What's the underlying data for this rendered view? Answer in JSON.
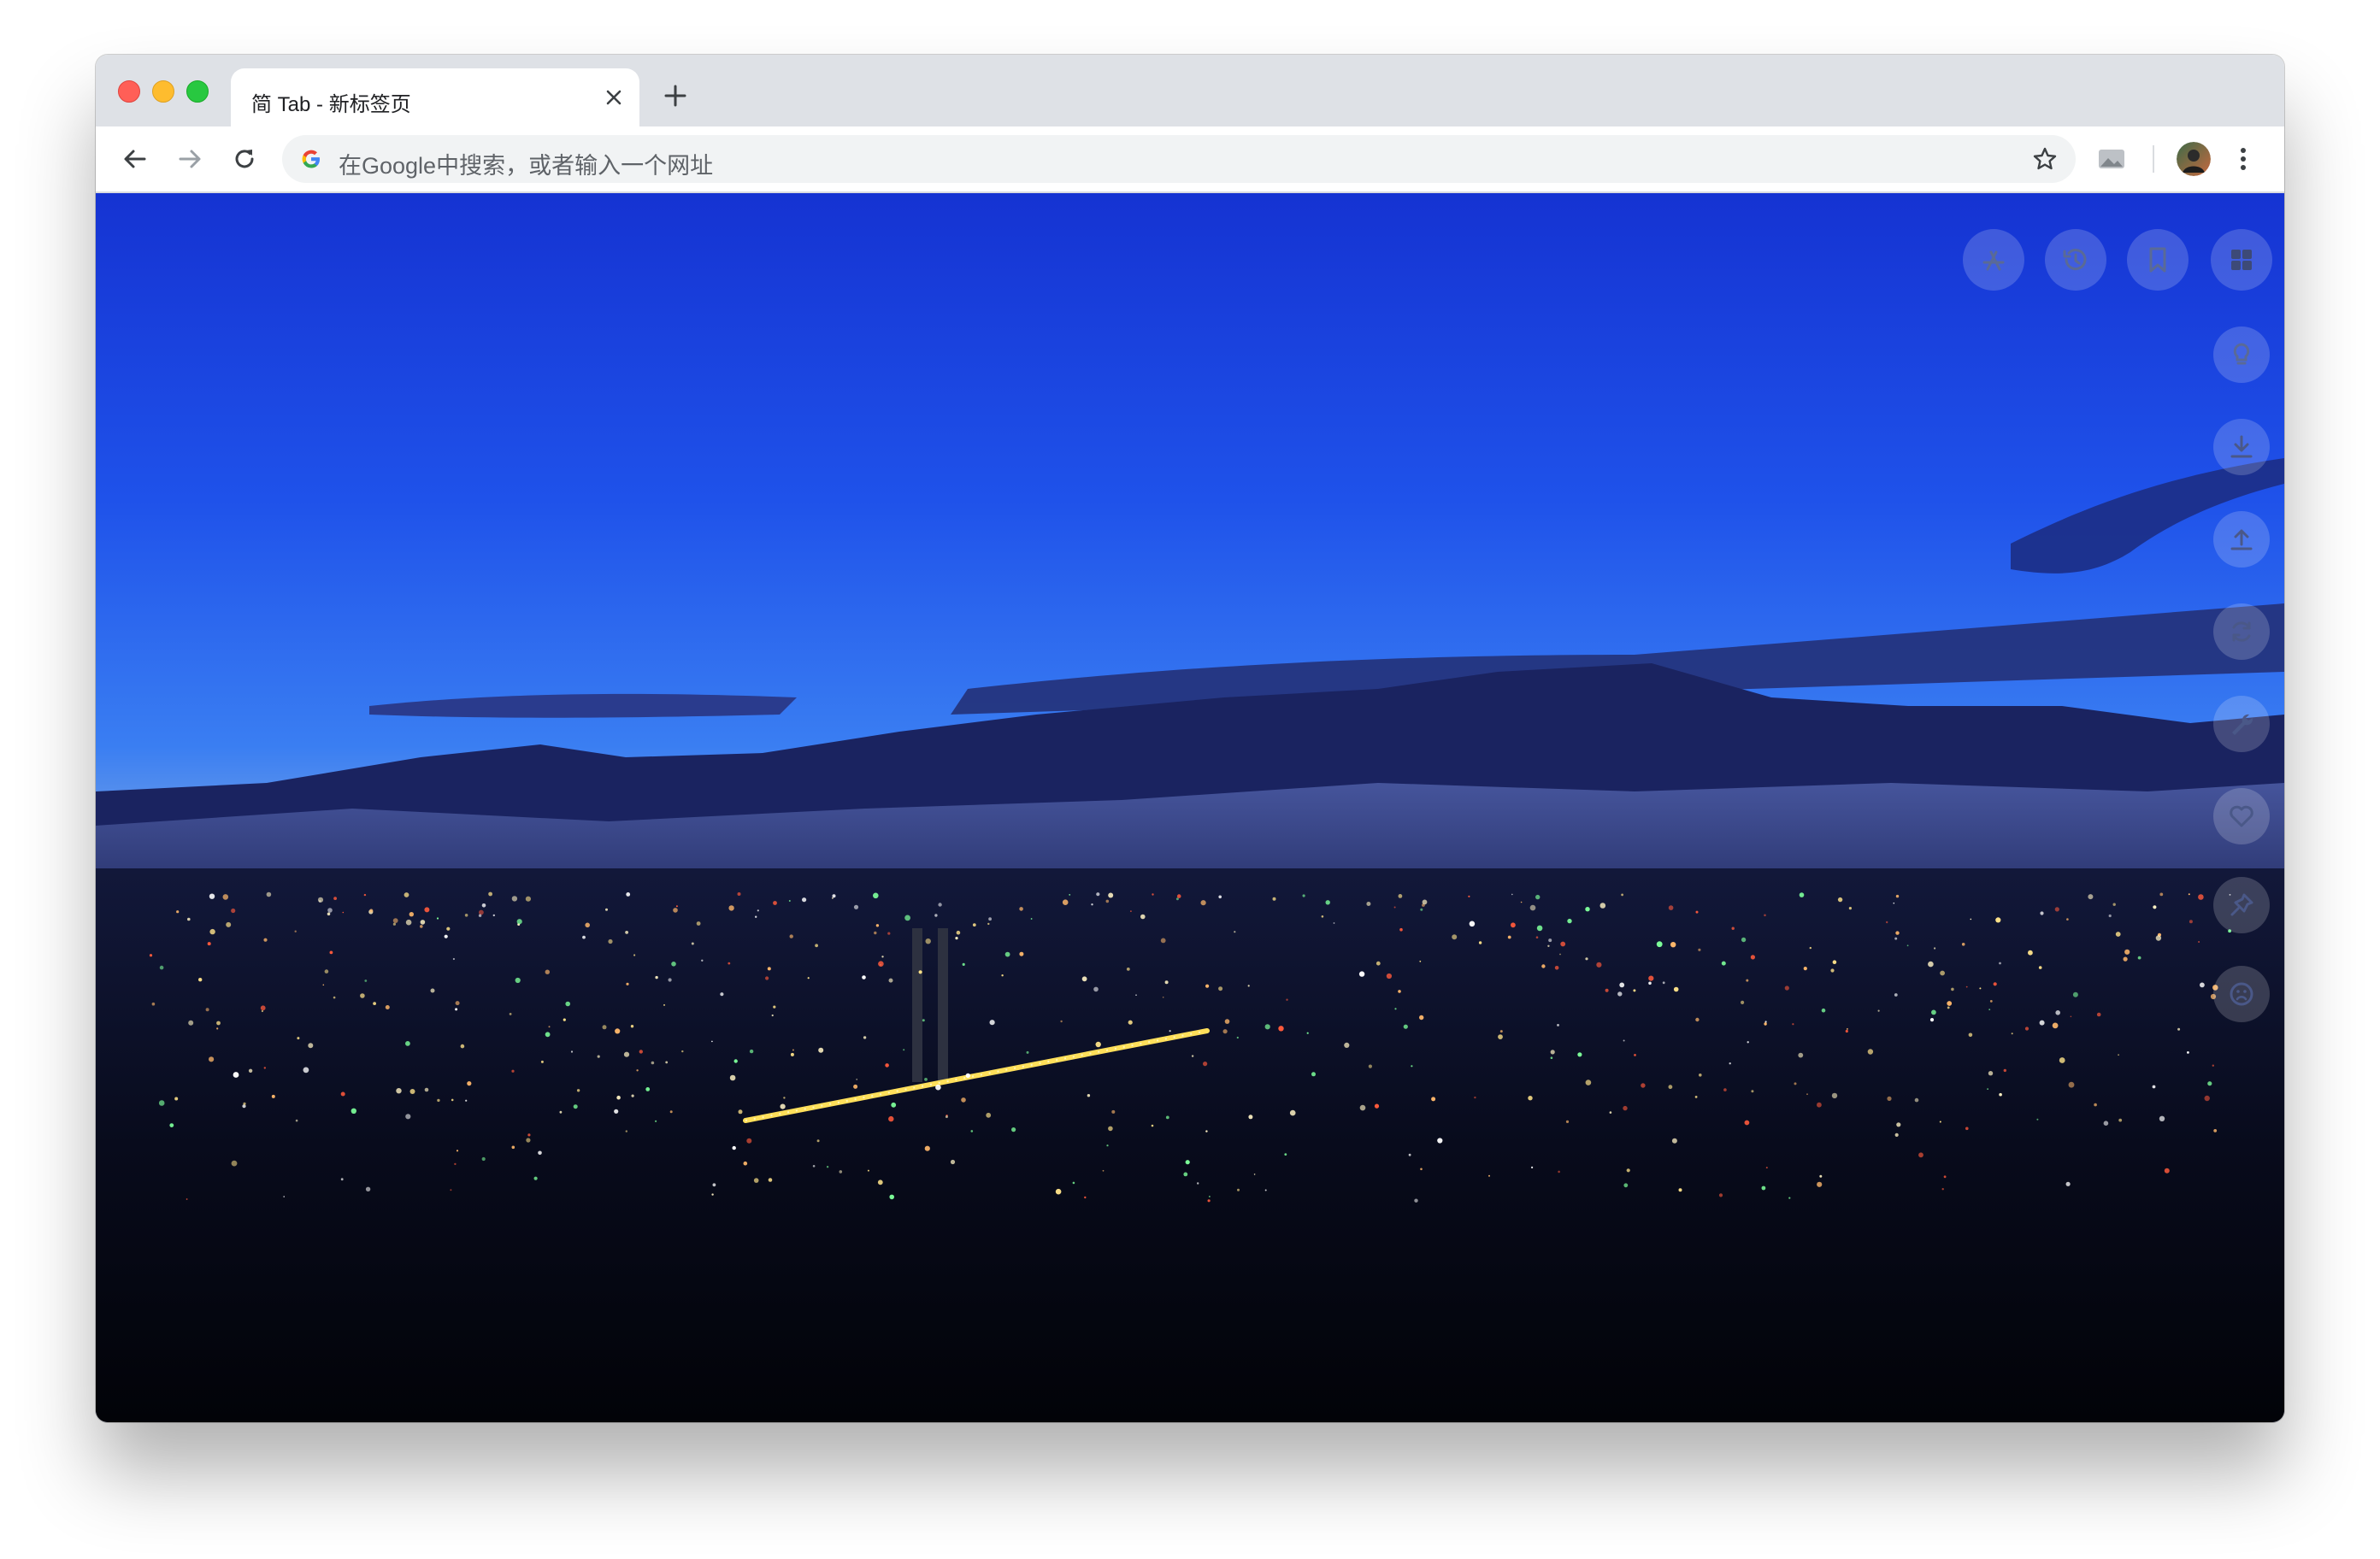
{
  "browser": {
    "tab": {
      "title": "简 Tab - 新标签页"
    },
    "omnibox": {
      "placeholder": "在Google中搜索，或者输入一个网址"
    }
  },
  "newtab": {
    "top_actions": [
      {
        "icon": "app-store-icon"
      },
      {
        "icon": "history-icon"
      },
      {
        "icon": "bookmark-icon"
      },
      {
        "icon": "grid-icon"
      }
    ],
    "side_actions": [
      {
        "icon": "lightbulb-icon"
      },
      {
        "icon": "download-icon"
      },
      {
        "icon": "upload-icon"
      },
      {
        "icon": "sync-icon"
      },
      {
        "icon": "wrench-icon"
      },
      {
        "icon": "heart-icon"
      },
      {
        "icon": "pin-icon"
      },
      {
        "icon": "frown-icon"
      }
    ]
  },
  "colors": {
    "tabstrip": "#dee1e6",
    "sky_top": "#1b3fe0",
    "sky_horizon": "#e39a8d",
    "city_lights": "#ffd24a"
  }
}
